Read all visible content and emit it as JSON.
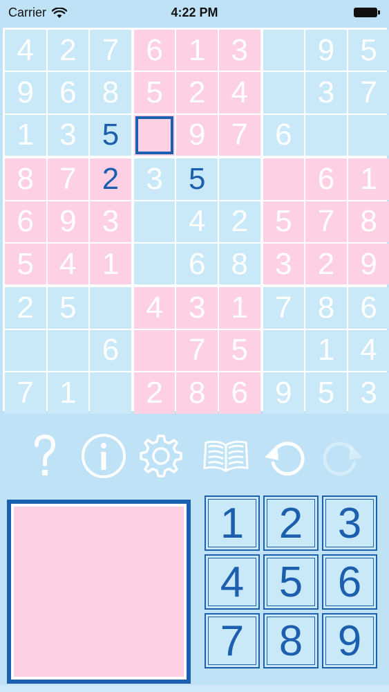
{
  "status_bar": {
    "carrier": "Carrier",
    "time": "4:22 PM"
  },
  "board": {
    "givens": [
      [
        "4",
        "2",
        "7",
        "6",
        "1",
        "3",
        "",
        "9",
        "5"
      ],
      [
        "9",
        "6",
        "8",
        "5",
        "2",
        "4",
        "",
        "3",
        "7"
      ],
      [
        "1",
        "3",
        "",
        "",
        "9",
        "7",
        "6",
        "",
        ""
      ],
      [
        "8",
        "7",
        "",
        "3",
        "",
        "",
        "",
        "6",
        "1"
      ],
      [
        "6",
        "9",
        "3",
        "",
        "4",
        "2",
        "5",
        "7",
        "8"
      ],
      [
        "5",
        "4",
        "1",
        "",
        "6",
        "8",
        "3",
        "2",
        "9"
      ],
      [
        "2",
        "5",
        "",
        "4",
        "3",
        "1",
        "7",
        "8",
        "6"
      ],
      [
        "",
        "",
        "6",
        "",
        "7",
        "5",
        "",
        "1",
        "4"
      ],
      [
        "7",
        "1",
        "",
        "2",
        "8",
        "6",
        "9",
        "5",
        "3"
      ]
    ],
    "entries": [
      {
        "row": 2,
        "col": 2,
        "value": "5"
      },
      {
        "row": 3,
        "col": 2,
        "value": "2"
      },
      {
        "row": 3,
        "col": 4,
        "value": "5"
      }
    ],
    "selected": {
      "row": 2,
      "col": 3
    },
    "pink_blocks": [
      1,
      3,
      5,
      7
    ],
    "colors": {
      "blue": "#c9e8f8",
      "pink": "#fdd1e3",
      "accent": "#1b5fae",
      "given_text": "#ffffff"
    }
  },
  "toolbar": [
    {
      "name": "help-button",
      "icon": "question-mark-icon"
    },
    {
      "name": "info-button",
      "icon": "info-circle-icon"
    },
    {
      "name": "settings-button",
      "icon": "gear-icon"
    },
    {
      "name": "rules-button",
      "icon": "open-book-icon"
    },
    {
      "name": "undo-button",
      "icon": "undo-icon"
    },
    {
      "name": "redo-button",
      "icon": "redo-icon"
    }
  ],
  "keypad": {
    "keys": [
      "1",
      "2",
      "3",
      "4",
      "5",
      "6",
      "7",
      "8",
      "9"
    ]
  }
}
